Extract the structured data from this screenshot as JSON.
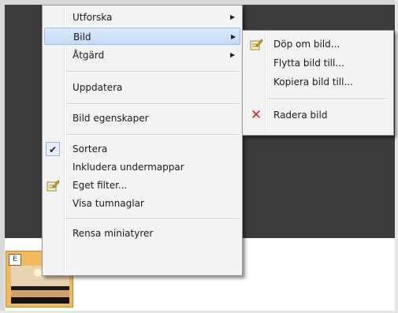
{
  "context_menu": {
    "items": [
      {
        "label": "Utforska",
        "has_submenu": true
      },
      {
        "label": "Bild",
        "has_submenu": true,
        "highlighted": true
      },
      {
        "label": "Åtgärd",
        "has_submenu": true
      },
      {
        "label": "Uppdatera"
      },
      {
        "label": "Bild egenskaper"
      },
      {
        "label": "Sortera",
        "checked": true
      },
      {
        "label": "Inkludera undermappar"
      },
      {
        "label": "Eget filter...",
        "icon": "edit-icon"
      },
      {
        "label": "Visa tumnaglar"
      },
      {
        "label": "Rensa miniatyrer"
      }
    ],
    "arrow_glyph": "▶",
    "check_glyph": "✔"
  },
  "submenu": {
    "items": [
      {
        "label": "Döp om bild...",
        "icon": "rename-icon"
      },
      {
        "label": "Flytta bild till..."
      },
      {
        "label": "Kopiera bild till..."
      },
      {
        "label": "Radera bild",
        "icon": "delete-icon"
      }
    ],
    "delete_glyph": "✕"
  },
  "thumbnail": {
    "badge": "E"
  },
  "colors": {
    "menu_bg": "#f3f3f3",
    "highlight": "#c3dbfa",
    "background": "#3b3b3b",
    "delete_icon": "#d8261c"
  }
}
